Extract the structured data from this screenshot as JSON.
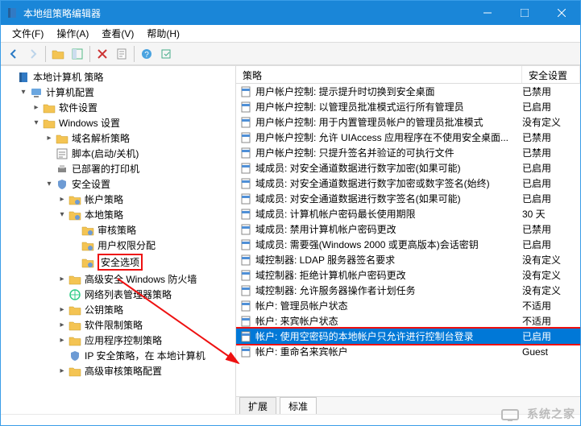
{
  "window": {
    "title": "本地组策略编辑器"
  },
  "menubar": {
    "file": "文件(F)",
    "action": "操作(A)",
    "view": "查看(V)",
    "help": "帮助(H)"
  },
  "columns": {
    "policy": "策略",
    "security": "安全设置"
  },
  "tree": {
    "root": "本地计算机 策略",
    "computer_config": "计算机配置",
    "software_settings": "软件设置",
    "windows_settings": "Windows 设置",
    "dns_policy": "域名解析策略",
    "scripts": "脚本(启动/关机)",
    "printers": "已部署的打印机",
    "security_settings": "安全设置",
    "account_policies": "帐户策略",
    "local_policies": "本地策略",
    "audit_policy": "审核策略",
    "user_rights": "用户权限分配",
    "security_options": "安全选项",
    "win_firewall": "高级安全 Windows 防火墙",
    "netlist_policy": "网络列表管理器策略",
    "public_key": "公钥策略",
    "software_restriction": "软件限制策略",
    "app_control": "应用程序控制策略",
    "ipsec": "IP 安全策略，在 本地计算机",
    "advanced_audit": "高级审核策略配置"
  },
  "policies": [
    {
      "name": "用户帐户控制: 提示提升时切换到安全桌面",
      "value": "已禁用"
    },
    {
      "name": "用户帐户控制: 以管理员批准模式运行所有管理员",
      "value": "已启用"
    },
    {
      "name": "用户帐户控制: 用于内置管理员帐户的管理员批准模式",
      "value": "没有定义"
    },
    {
      "name": "用户帐户控制: 允许 UIAccess 应用程序在不使用安全桌面...",
      "value": "已禁用"
    },
    {
      "name": "用户帐户控制: 只提升签名并验证的可执行文件",
      "value": "已禁用"
    },
    {
      "name": "域成员: 对安全通道数据进行数字加密(如果可能)",
      "value": "已启用"
    },
    {
      "name": "域成员: 对安全通道数据进行数字加密或数字签名(始终)",
      "value": "已启用"
    },
    {
      "name": "域成员: 对安全通道数据进行数字签名(如果可能)",
      "value": "已启用"
    },
    {
      "name": "域成员: 计算机帐户密码最长使用期限",
      "value": "30 天"
    },
    {
      "name": "域成员: 禁用计算机帐户密码更改",
      "value": "已禁用"
    },
    {
      "name": "域成员: 需要强(Windows 2000 或更高版本)会话密钥",
      "value": "已启用"
    },
    {
      "name": "域控制器: LDAP 服务器签名要求",
      "value": "没有定义"
    },
    {
      "name": "域控制器: 拒绝计算机帐户密码更改",
      "value": "没有定义"
    },
    {
      "name": "域控制器: 允许服务器操作者计划任务",
      "value": "没有定义"
    },
    {
      "name": "帐户: 管理员帐户状态",
      "value": "不适用"
    },
    {
      "name": "帐户: 来宾帐户状态",
      "value": "不适用"
    },
    {
      "name": "帐户: 使用空密码的本地帐户只允许进行控制台登录",
      "value": "已启用",
      "selected": true
    },
    {
      "name": "帐户: 重命名来宾帐户",
      "value": "Guest"
    }
  ],
  "tabs": {
    "extended": "扩展",
    "standard": "标准"
  },
  "watermark": "系统之家"
}
